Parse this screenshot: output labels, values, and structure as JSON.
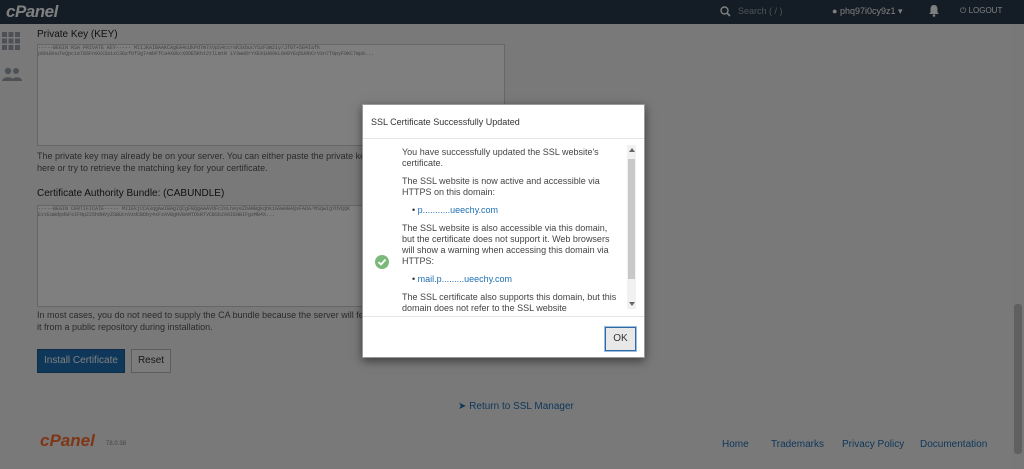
{
  "header": {
    "logo": "cPanel",
    "search_placeholder": "Search ( / )",
    "username": "phq97i0cy9z1",
    "logout": "LOGOUT"
  },
  "sidebar": {
    "icons": [
      "grid-icon",
      "users-icon"
    ]
  },
  "main": {
    "private_key_label": "Private Key (KEY)",
    "private_key_value": "-----BEGIN RSA PRIVATE KEY----- MIIJKAIBAAKCAgEA4cUkPd7m7xVpS4ccrsK3xbucYSzF3m2iy/Jf0T+584Iafk p6bU9nuTeQpcie786Fn9XX3a1xC3GzfDf3g7+mbFfCa4X0kcXOOE5Kht2tlLmtR 1Y3weDrYXE9iH09kL6H9YEq5U9bCrVXn7T9pyF9KC7Wp8...",
    "private_key_help": "The private key may already be on your server. You can either paste the private key here or try to retrieve the matching key for your certificate.",
    "cabundle_label": "Certificate Authority Bundle: (CABUNDLE)",
    "cabundle_value": "-----BEGIN CERTIFICATE----- MIIEkjCCA3qgAwIBAgIQCgFBQgAAAVOFc2oLheyeZDANBgkqhkiG9w0BAQsFADA/MSQwIgYDVQQK ExtEaWdpdGFsIFNpZ25hdHVyZSBUcnVzdCBDby4xFzAVBgNVBAMTDkRTVCBSb290IENBIFgzMB4X...",
    "cabundle_help": "In most cases, you do not need to supply the CA bundle because the server will fetch it from a public repository during installation.",
    "install_button": "Install Certificate",
    "reset_button": "Reset",
    "return_link": "Return to SSL Manager"
  },
  "footer": {
    "logo": "cPanel",
    "version": "78.0.38",
    "links": [
      "Home",
      "Trademarks",
      "Privacy Policy",
      "Documentation"
    ]
  },
  "modal": {
    "title": "SSL Certificate Successfully Updated",
    "p1": "You have successfully updated the SSL website's certificate.",
    "p2": "The SSL website is now active and accessible via HTTPS on this domain:",
    "domain1": "p...........ueechy.com",
    "p3": "The SSL website is also accessible via this domain, but the certificate does not support it. Web browsers will show a warning when accessing this domain via HTTPS:",
    "domain2": "mail.p.........ueechy.com",
    "p4": "The SSL certificate also supports this domain, but this domain does not refer to the SSL website",
    "ok_button": "OK"
  },
  "colors": {
    "topbar": "#293a4a",
    "accent": "#1f6fb4",
    "brand_orange": "#ff6c2c",
    "success": "#7ab97a"
  }
}
